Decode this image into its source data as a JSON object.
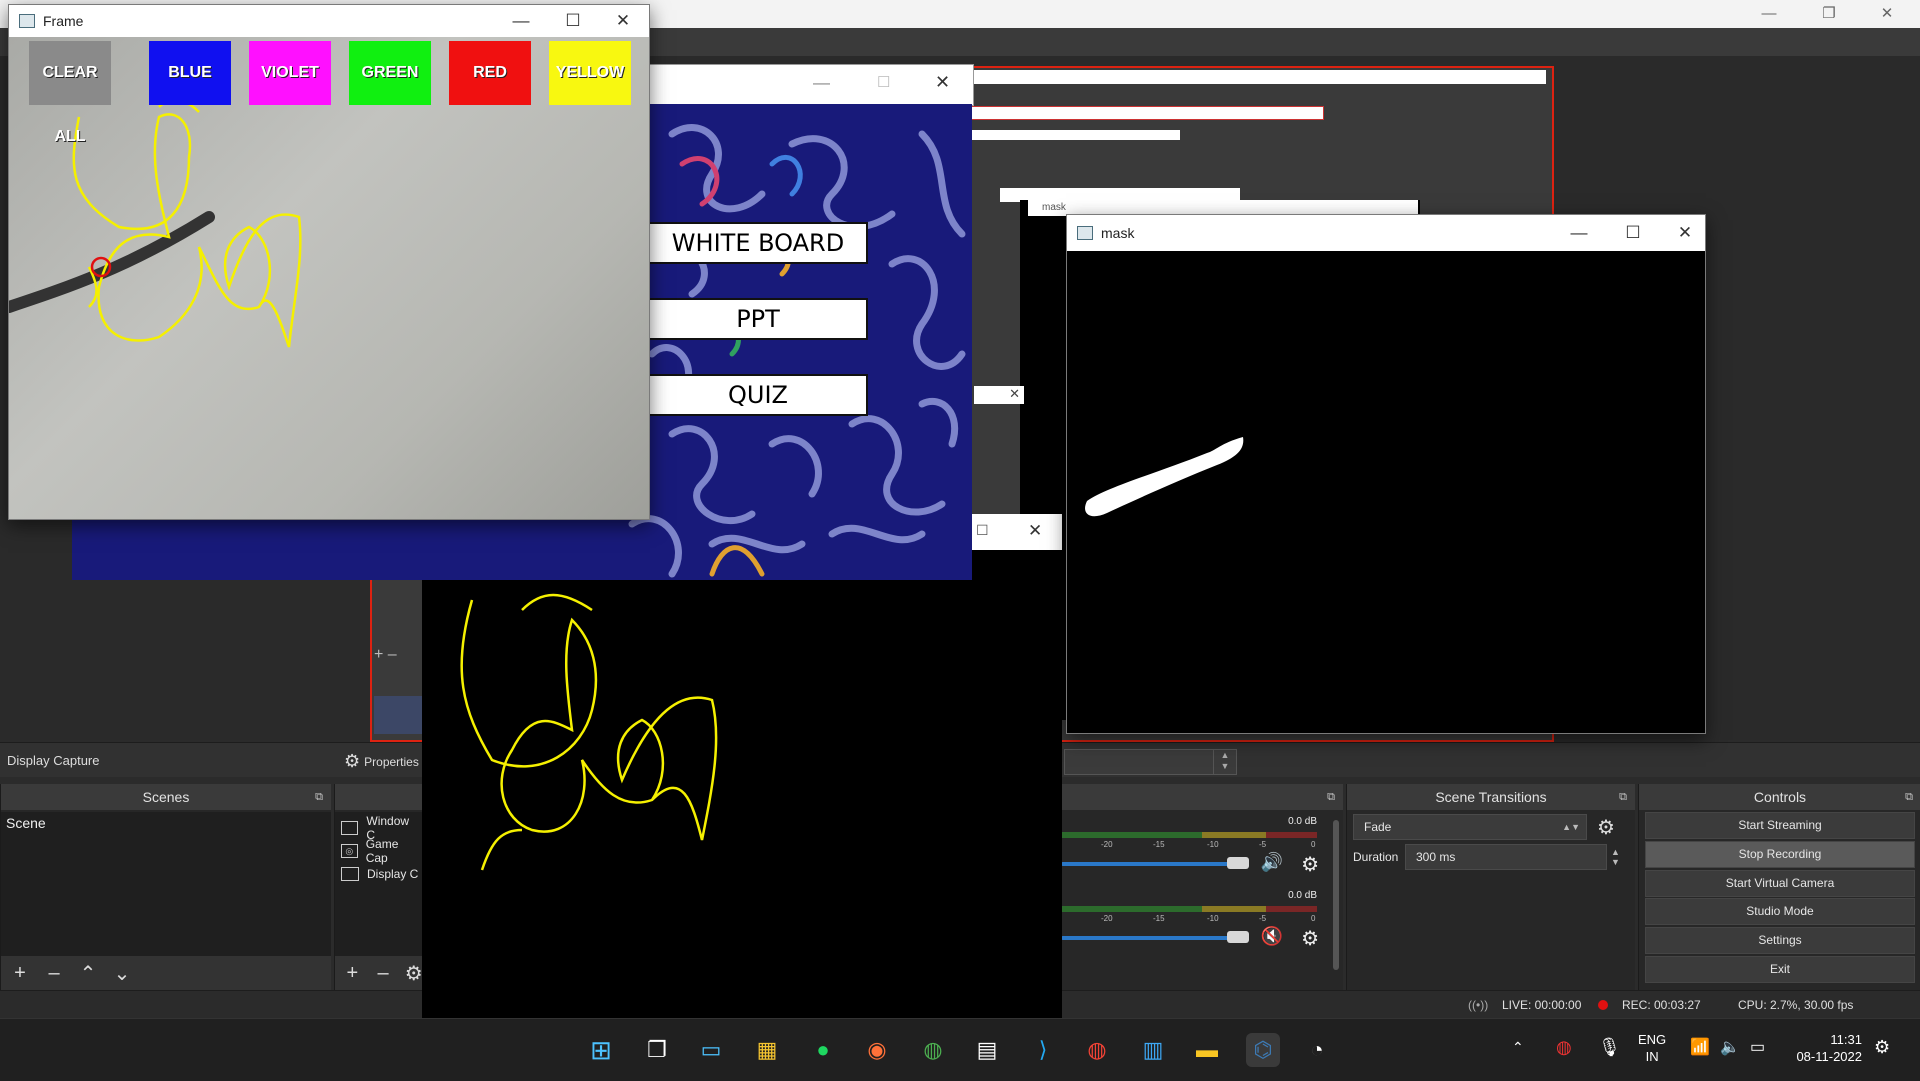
{
  "frame_window": {
    "title": "Frame",
    "buttons": [
      {
        "label": "CLEAR ALL",
        "color": "#8a8a8a"
      },
      {
        "label": "BLUE",
        "color": "#1010f0"
      },
      {
        "label": "VIOLET",
        "color": "#ff10ff"
      },
      {
        "label": "GREEN",
        "color": "#10f010"
      },
      {
        "label": "RED",
        "color": "#f01010"
      },
      {
        "label": "YELLOW",
        "color": "#f8f810"
      }
    ],
    "ink_color": "#f5f000"
  },
  "menu_window": {
    "buttons": [
      "WHITE BOARD",
      "PPT",
      "QUIZ"
    ],
    "background_color": "#181a7a"
  },
  "mask_window": {
    "title": "mask"
  },
  "small_mask_title": "mask",
  "obs": {
    "source_label": "Display Capture",
    "properties_label": "Properties",
    "scenes": {
      "title": "Scenes",
      "items": [
        "Scene"
      ]
    },
    "sources": [
      "Window C",
      "Game Cap",
      "Display C"
    ],
    "mixer": [
      {
        "db": "0.0 dB",
        "muted": false
      },
      {
        "db": "0.0 dB",
        "muted": true
      }
    ],
    "ticks": [
      "-20",
      "-15",
      "-10",
      "-5",
      "0"
    ],
    "transitions": {
      "title": "Scene Transitions",
      "type": "Fade",
      "duration_label": "Duration",
      "duration": "300 ms"
    },
    "controls": {
      "title": "Controls",
      "buttons": [
        "Start Streaming",
        "Stop Recording",
        "Start Virtual Camera",
        "Studio Mode",
        "Settings",
        "Exit"
      ]
    },
    "status": {
      "live": "LIVE: 00:00:00",
      "rec": "REC: 00:03:27",
      "cpu": "CPU: 2.7%, 30.00 fps"
    }
  },
  "taskbar": {
    "lang_top": "ENG",
    "lang_bottom": "IN",
    "time": "11:31",
    "date": "08-11-2022",
    "icons": [
      "windows-start",
      "task-view",
      "desktop",
      "store",
      "spotify",
      "firefox",
      "chrome",
      "terminal",
      "vscode",
      "chrome-profile",
      "notepad",
      "file-explorer",
      "python",
      "obs"
    ]
  }
}
